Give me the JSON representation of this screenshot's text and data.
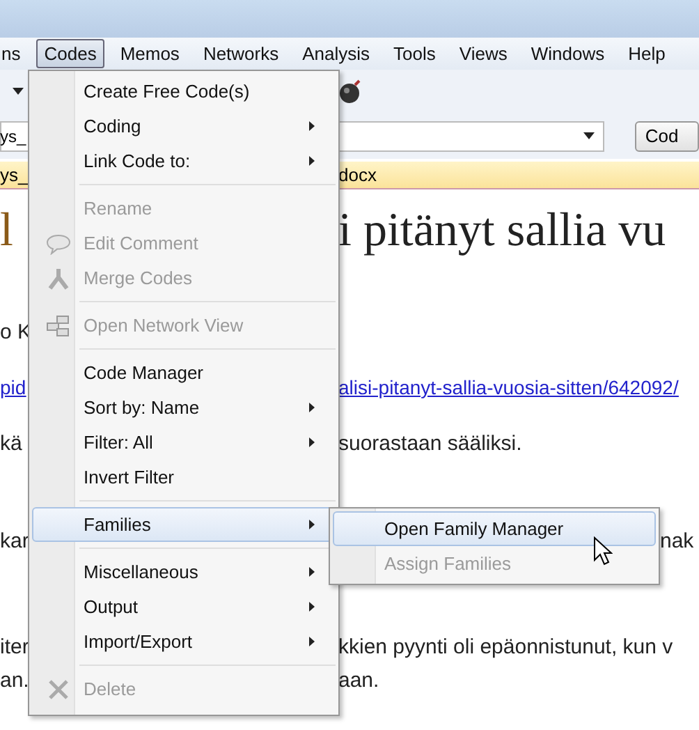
{
  "menubar": [
    {
      "label": "ns",
      "selected": false
    },
    {
      "label": "Codes",
      "selected": true
    },
    {
      "label": "Memos",
      "selected": false
    },
    {
      "label": "Networks",
      "selected": false
    },
    {
      "label": "Analysis",
      "selected": false
    },
    {
      "label": "Tools",
      "selected": false
    },
    {
      "label": "Views",
      "selected": false
    },
    {
      "label": "Windows",
      "selected": false
    },
    {
      "label": "Help",
      "selected": false
    }
  ],
  "combo": {
    "value": "ys_"
  },
  "code_button": "Cod",
  "doc_tab": {
    "left": "ys_",
    "right": "docx"
  },
  "document": [
    {
      "kind": "title",
      "left": "l",
      "right": "i pitänyt sallia vu"
    },
    {
      "kind": "text",
      "left": "o K"
    },
    {
      "kind": "link",
      "left": "pid",
      "right": "alisi-pitanyt-sallia-vuosia-sitten/642092/"
    },
    {
      "kind": "text",
      "left": "kä",
      "right": "suorastaan sääliksi."
    },
    {
      "kind": "text",
      "left": "kar",
      "after_submenu": "nak"
    },
    {
      "kind": "text",
      "left": "iter",
      "right": "kkien pyynti oli epäonnistunut, kun v"
    },
    {
      "kind": "text",
      "left": "an.",
      "right": "aan."
    }
  ],
  "menu": [
    {
      "kind": "item",
      "label": "Create Free Code(s)",
      "disabled": false,
      "submenu": false,
      "selected": false
    },
    {
      "kind": "item",
      "label": "Coding",
      "disabled": false,
      "submenu": true,
      "selected": false
    },
    {
      "kind": "item",
      "label": "Link Code to:",
      "disabled": false,
      "submenu": true,
      "selected": false
    },
    {
      "kind": "separator"
    },
    {
      "kind": "item",
      "label": "Rename",
      "disabled": true,
      "submenu": false,
      "selected": false
    },
    {
      "kind": "comment",
      "label": "Edit Comment",
      "disabled": true,
      "submenu": false,
      "selected": false
    },
    {
      "kind": "merge",
      "label": "Merge Codes",
      "disabled": true,
      "submenu": false,
      "selected": false
    },
    {
      "kind": "separator"
    },
    {
      "kind": "network",
      "label": "Open Network View",
      "disabled": true,
      "submenu": false,
      "selected": false
    },
    {
      "kind": "separator"
    },
    {
      "kind": "item",
      "label": "Code Manager",
      "disabled": false,
      "submenu": false,
      "selected": false
    },
    {
      "kind": "item",
      "label": "Sort by: Name",
      "disabled": false,
      "submenu": true,
      "selected": false
    },
    {
      "kind": "item",
      "label": "Filter: All",
      "disabled": false,
      "submenu": true,
      "selected": false
    },
    {
      "kind": "item",
      "label": "Invert Filter",
      "disabled": false,
      "submenu": false,
      "selected": false
    },
    {
      "kind": "separator"
    },
    {
      "kind": "item",
      "label": "Families",
      "disabled": false,
      "submenu": true,
      "selected": true
    },
    {
      "kind": "separator"
    },
    {
      "kind": "item",
      "label": "Miscellaneous",
      "disabled": false,
      "submenu": true,
      "selected": false
    },
    {
      "kind": "item",
      "label": "Output",
      "disabled": false,
      "submenu": true,
      "selected": false
    },
    {
      "kind": "item",
      "label": "Import/Export",
      "disabled": false,
      "submenu": true,
      "selected": false
    },
    {
      "kind": "separator"
    },
    {
      "kind": "delete",
      "label": "Delete",
      "disabled": true,
      "submenu": false,
      "selected": false
    }
  ],
  "submenu": [
    {
      "label": "Open Family Manager",
      "disabled": false,
      "selected": true
    },
    {
      "label": "Assign Families",
      "disabled": true,
      "selected": false
    }
  ]
}
